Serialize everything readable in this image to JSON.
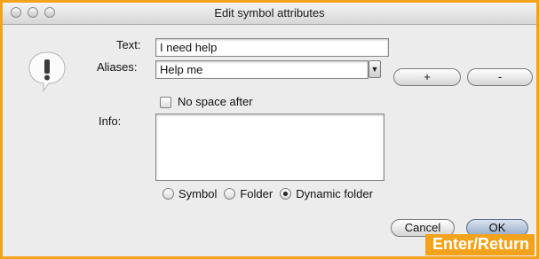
{
  "window": {
    "title": "Edit symbol attributes"
  },
  "form": {
    "text_label": "Text:",
    "text_value": "I need help",
    "aliases_label": "Aliases:",
    "aliases_value": "Help me",
    "add_label": "+",
    "remove_label": "-",
    "no_space_label": "No space after",
    "info_label": "Info:",
    "info_value": ""
  },
  "type_options": [
    {
      "label": "Symbol",
      "selected": false
    },
    {
      "label": "Folder",
      "selected": false
    },
    {
      "label": "Dynamic folder",
      "selected": true
    }
  ],
  "buttons": {
    "cancel_label": "Cancel",
    "ok_label": "OK"
  },
  "overlay": {
    "hint": "Enter/Return"
  },
  "colors": {
    "accent": "#f3a21b",
    "default_button": "#94aac6"
  }
}
